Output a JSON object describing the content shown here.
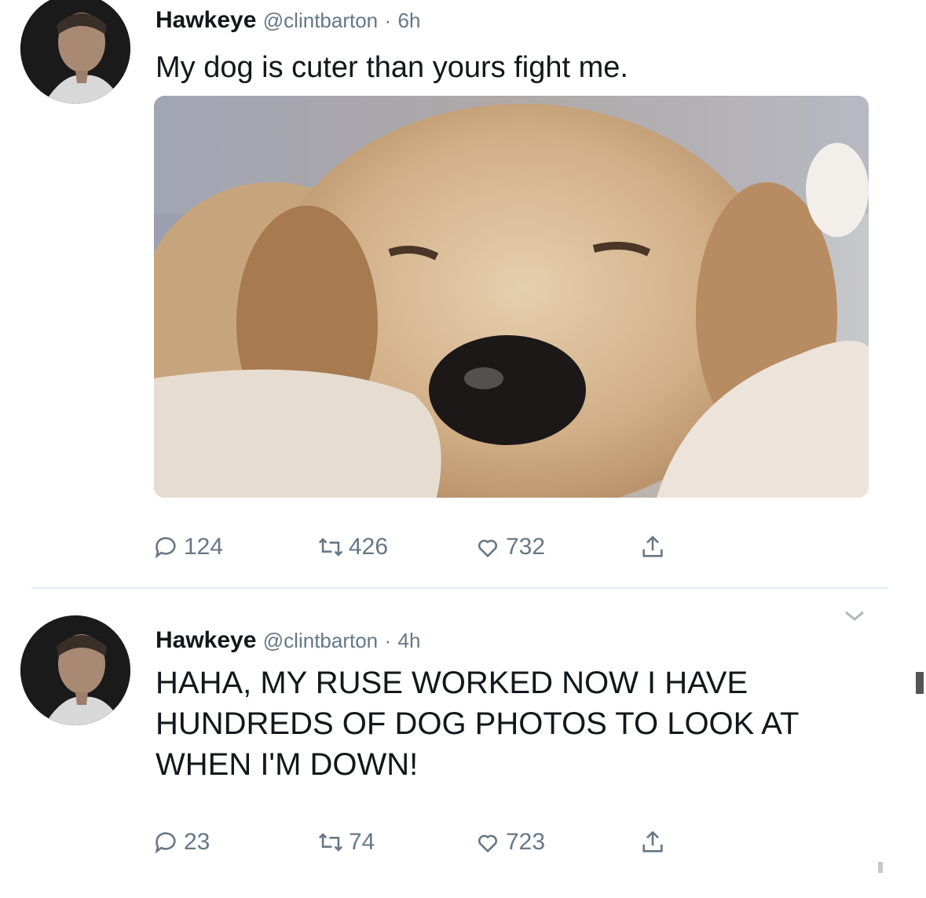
{
  "tweets": [
    {
      "name": "Hawkeye",
      "handle": "@clintbarton",
      "separator": "·",
      "time": "6h",
      "text": "My dog is cuter than yours fight me.",
      "media": "photo of a sleeping golden retriever on a blanket",
      "stats": {
        "replies": "124",
        "retweets": "426",
        "likes": "732"
      }
    },
    {
      "name": "Hawkeye",
      "handle": "@clintbarton",
      "separator": "·",
      "time": "4h",
      "text": "HAHA, MY RUSE WORKED NOW I HAVE HUNDREDS OF DOG PHOTOS TO LOOK AT WHEN I'M DOWN!",
      "stats": {
        "replies": "23",
        "retweets": "74",
        "likes": "723"
      }
    }
  ],
  "colors": {
    "text": "#14171a",
    "secondary": "#657786",
    "divider": "#e6ecf0"
  },
  "icons": [
    "reply-icon",
    "retweet-icon",
    "like-icon",
    "share-icon",
    "caret-down-icon"
  ]
}
